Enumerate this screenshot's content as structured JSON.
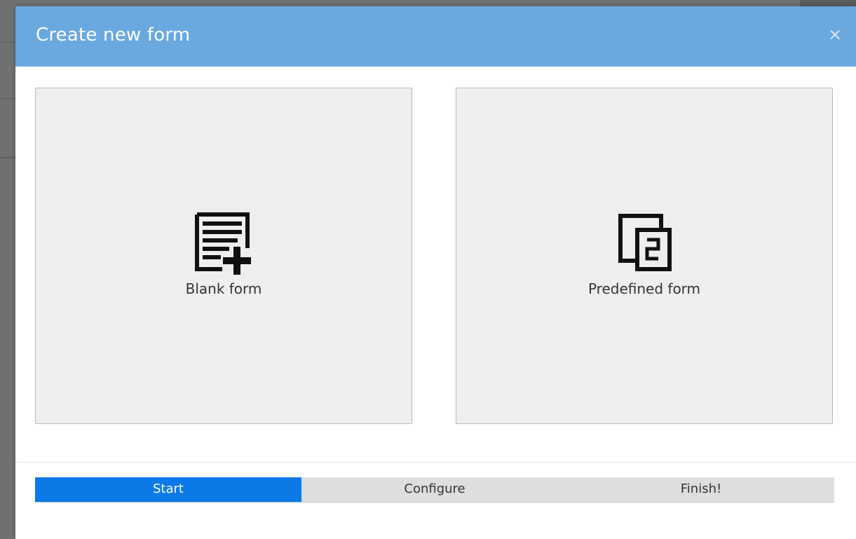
{
  "dialog": {
    "title": "Create new form",
    "close_glyph": "×"
  },
  "options": [
    {
      "label": "Blank form",
      "icon": "blank-form-add-icon"
    },
    {
      "label": "Predefined form",
      "icon": "predefined-form-copy-icon"
    }
  ],
  "steps": [
    {
      "label": "Start",
      "active": true
    },
    {
      "label": "Configure",
      "active": false
    },
    {
      "label": "Finish!",
      "active": false
    }
  ],
  "colors": {
    "header": "#6aa8e0",
    "active_step": "#0b7ae6",
    "card_background": "#eeeeee"
  }
}
